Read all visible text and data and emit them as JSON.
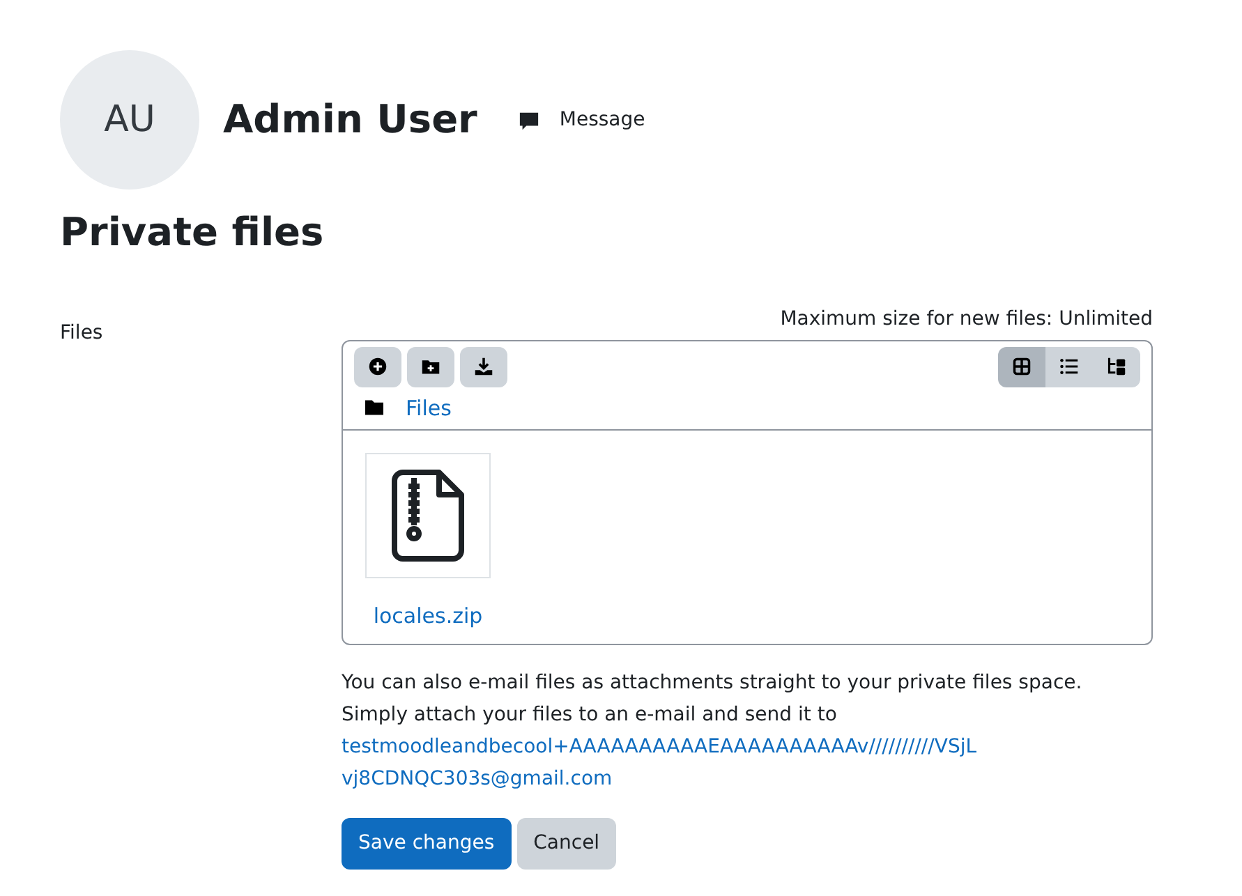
{
  "user": {
    "initials": "AU",
    "name": "Admin User",
    "message_link": "Message"
  },
  "heading": "Private files",
  "field_label": "Files",
  "max_size": "Maximum size for new files: Unlimited",
  "toolbar": [
    {
      "kind": "add"
    },
    {
      "kind": "new-folder"
    },
    {
      "kind": "download"
    }
  ],
  "view_modes": [
    {
      "kind": "icons",
      "selected": true
    },
    {
      "kind": "list",
      "selected": false
    },
    {
      "kind": "tree",
      "selected": false
    }
  ],
  "path": "Files",
  "files": [
    {
      "kind": "zip",
      "name": "locales.zip"
    }
  ],
  "note": "You can also e-mail files as attachments straight to your private files space. Simply attach your files to an e-mail and send it to",
  "email": "testmoodleandbecool+AAAAAAAAAAEAAAAAAAAAAv//////////VSjLvj8CDNQC303s@gmail.com",
  "buttons": [
    {
      "kind": "primary",
      "label": "Save changes"
    },
    {
      "kind": "secondary",
      "label": "Cancel"
    }
  ]
}
